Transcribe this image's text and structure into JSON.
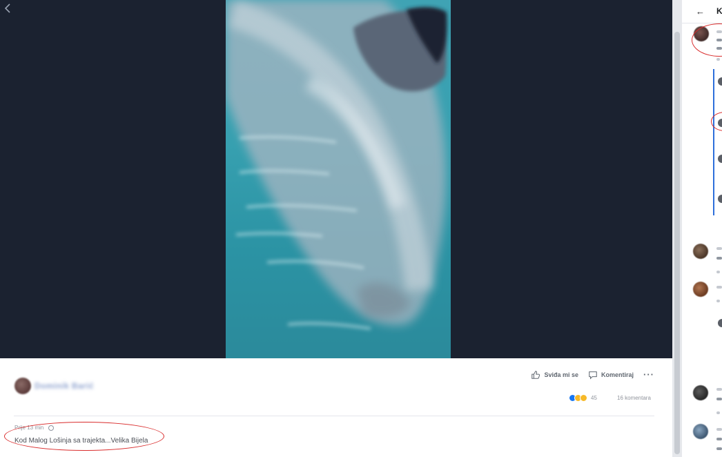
{
  "post": {
    "author_name": "Dominik Barić",
    "actions": {
      "like_label": "Sviđa mi se",
      "comment_label": "Komentiraj",
      "more_label": "···"
    },
    "reactions_count": "45",
    "comments_count": "16 komentara",
    "time": "Prije 13 min",
    "caption": "Kod Malog Lošinja sa trajekta...Velika Bijela"
  },
  "panel": {
    "back_icon": "←",
    "title_initial": "K"
  },
  "colors": {
    "viewer_bg": "#1b2230",
    "water": "#37a0b0",
    "annotation_red": "#d92b2b",
    "link_blue": "#2d6fdb"
  }
}
